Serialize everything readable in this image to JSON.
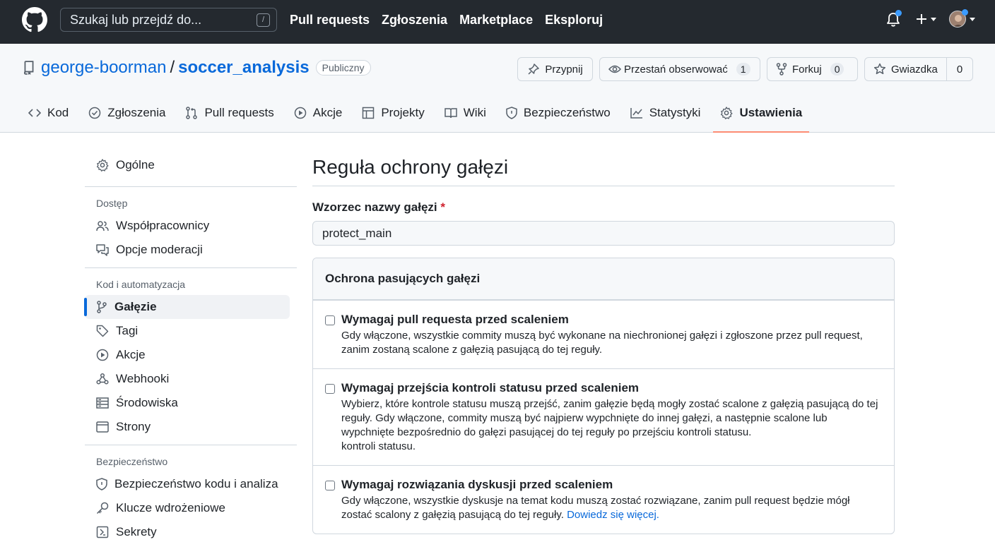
{
  "header": {
    "search_placeholder": "Szukaj lub przejdź do...",
    "search_shortcut": "/",
    "nav": [
      "Pull requests",
      "Zgłoszenia",
      "Marketplace",
      "Eksploruj"
    ]
  },
  "repo": {
    "owner": "george-boorman",
    "separator": "/",
    "name": "soccer_analysis",
    "visibility": "Publiczny",
    "pin_label": "Przypnij",
    "watch_label": "Przestań obserwować",
    "watch_count": "1",
    "fork_label": "Forkuj",
    "fork_count": "0",
    "star_label": "Gwiazdka",
    "star_count": "0"
  },
  "tabs": [
    {
      "label": "Kod",
      "icon": "code-icon"
    },
    {
      "label": "Zgłoszenia",
      "icon": "issue-icon"
    },
    {
      "label": "Pull requests",
      "icon": "pull-request-icon"
    },
    {
      "label": "Akcje",
      "icon": "play-icon"
    },
    {
      "label": "Projekty",
      "icon": "table-icon"
    },
    {
      "label": "Wiki",
      "icon": "book-icon"
    },
    {
      "label": "Bezpieczeństwo",
      "icon": "shield-icon"
    },
    {
      "label": "Statystyki",
      "icon": "graph-icon"
    },
    {
      "label": "Ustawienia",
      "icon": "gear-icon",
      "active": true
    }
  ],
  "sidebar": {
    "general": "Ogólne",
    "access_heading": "Dostęp",
    "access_items": [
      "Współpracownicy",
      "Opcje moderacji"
    ],
    "code_heading": "Kod i automatyzacja",
    "code_items": [
      "Gałęzie",
      "Tagi",
      "Akcje",
      "Webhooki",
      "Środowiska",
      "Strony"
    ],
    "security_heading": "Bezpieczeństwo",
    "security_items": [
      "Bezpieczeństwo kodu i analiza",
      "Klucze wdrożeniowe",
      "Sekrety"
    ]
  },
  "main": {
    "title": "Reguła ochrony gałęzi",
    "pattern_label": "Wzorzec nazwy gałęzi",
    "required_mark": "*",
    "pattern_value": "protect_main",
    "box_heading": "Ochrona pasujących gałęzi",
    "rules": [
      {
        "title": "Wymagaj pull requesta przed scaleniem",
        "desc": "Gdy włączone, wszystkie commity muszą być wykonane na niechronionej gałęzi i zgłoszone przez pull request, zanim zostaną scalone z gałęzią pasującą do tej reguły."
      },
      {
        "title": "Wymagaj przejścia kontroli statusu przed scaleniem",
        "desc": "Wybierz, które kontrole statusu muszą przejść, zanim gałęzie będą mogły zostać scalone z gałęzią pasującą do tej reguły. Gdy włączone, commity muszą być najpierw wypchnięte do innej gałęzi, a następnie scalone lub wypchnięte bezpośrednio do gałęzi pasującej do tej reguły po przejściu kontroli statusu.",
        "desc_extra": "kontroli statusu."
      },
      {
        "title": "Wymagaj rozwiązania dyskusji przed scaleniem",
        "desc": "Gdy włączone, wszystkie dyskusje na temat kodu muszą zostać rozwiązane, zanim pull request będzie mógł zostać scalony z gałęzią pasującą do tej reguły.",
        "link": "Dowiedz się więcej."
      }
    ]
  }
}
